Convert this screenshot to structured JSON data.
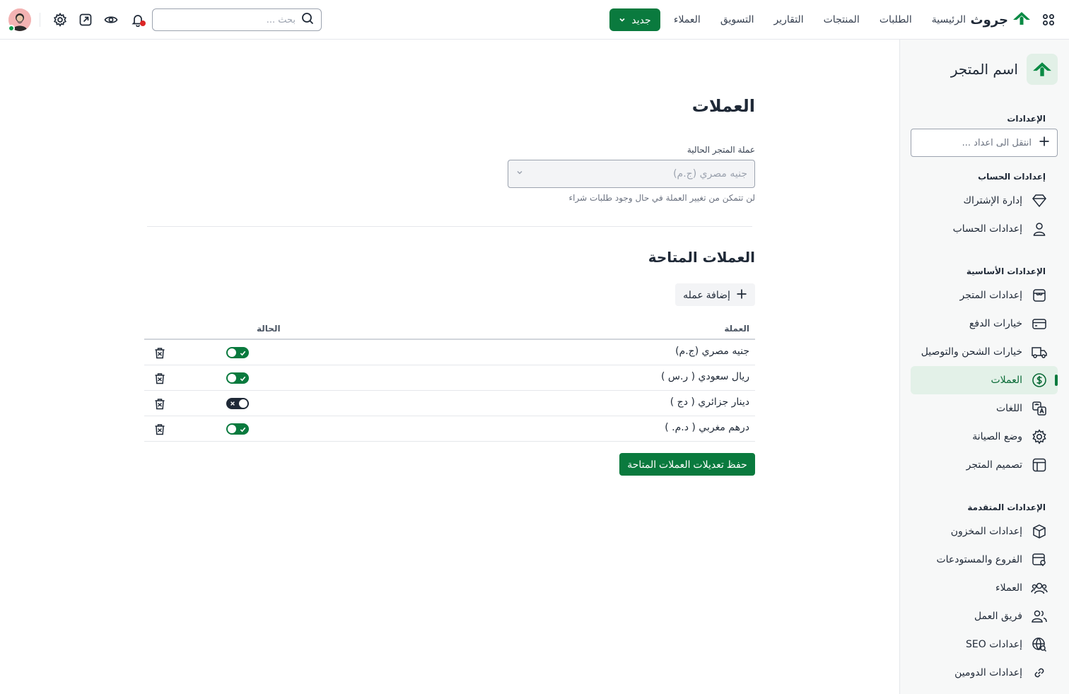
{
  "topbar": {
    "brand": "جروث",
    "nav": [
      "الرئيسية",
      "الطلبات",
      "المنتجات",
      "التقارير",
      "التسويق",
      "العملاء"
    ],
    "new_label": "جديد",
    "search_placeholder": "بحث ...",
    "icons": [
      "apps-grid-icon",
      "brand-logo-icon",
      "search-icon",
      "bell-icon",
      "eye-icon",
      "external-link-icon",
      "gear-icon",
      "avatar"
    ],
    "accent": "#0a7a3e",
    "notification_color": "#dc2626"
  },
  "sidebar": {
    "store_name": "اسم المتجر",
    "settings_title": "الإعدادات",
    "goto_placeholder": "انتقل الى اعداد ...",
    "groups": [
      {
        "title": "إعدادات الحساب",
        "items": [
          {
            "label": "إدارة الإشتراك",
            "icon": "diamond-icon"
          },
          {
            "label": "إعدادات الحساب",
            "icon": "user-icon"
          }
        ]
      },
      {
        "title": "الإعدادات الأساسية",
        "items": [
          {
            "label": "إعدادات المتجر",
            "icon": "store-icon"
          },
          {
            "label": "خيارات الدفع",
            "icon": "credit-card-icon"
          },
          {
            "label": "خيارات الشحن والتوصيل",
            "icon": "truck-icon"
          },
          {
            "label": "العملات",
            "icon": "dollar-circle-icon",
            "active": true
          },
          {
            "label": "اللغات",
            "icon": "translate-icon"
          },
          {
            "label": "وضع الصيانة",
            "icon": "cog-icon"
          },
          {
            "label": "تصميم المتجر",
            "icon": "layout-icon"
          }
        ]
      },
      {
        "title": "الإعدادات المتقدمة",
        "items": [
          {
            "label": "إعدادات المخزون",
            "icon": "box-icon"
          },
          {
            "label": "الفروع والمستودعات",
            "icon": "warehouse-icon"
          },
          {
            "label": "العملاء",
            "icon": "users-icon"
          },
          {
            "label": "فريق العمل",
            "icon": "team-icon"
          },
          {
            "label": "إعدادات SEO",
            "icon": "globe-icon"
          },
          {
            "label": "إعدادات الدومين",
            "icon": "link-icon"
          }
        ]
      }
    ]
  },
  "main": {
    "title": "العملات",
    "current_label": "عملة المتجر الحالية",
    "current_value": "جنيه مصري (ج.م)",
    "help": "لن تتمكن من تغيير العملة في حال وجود طلبات شراء",
    "available_title": "العملات المتاحة",
    "add_label": "إضافة عمله",
    "columns": {
      "currency": "العملة",
      "status": "الحالة"
    },
    "rows": [
      {
        "name": "جنيه مصري (ج.م)",
        "enabled": true
      },
      {
        "name": "ريال سعودي ( ر.س )",
        "enabled": true
      },
      {
        "name": "دينار جزائري ( دج )",
        "enabled": false
      },
      {
        "name": "درهم مغربي ( د.م. )",
        "enabled": true
      }
    ],
    "save_label": "حفظ تعديلات العملات المتاحة"
  }
}
